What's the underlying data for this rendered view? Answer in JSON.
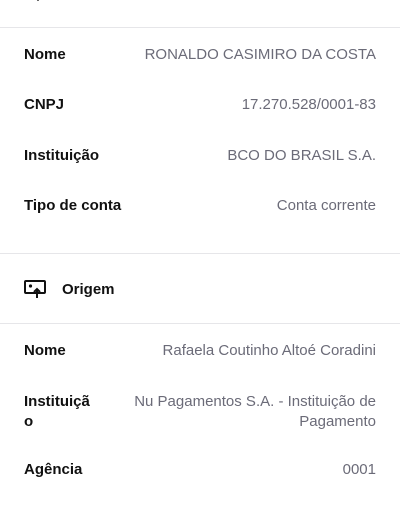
{
  "destination": {
    "rows": [
      {
        "label": "Nome",
        "value": "RONALDO CASIMIRO DA COSTA"
      },
      {
        "label": "CNPJ",
        "value": "17.270.528/0001-83"
      },
      {
        "label": "Instituição",
        "value": "BCO DO BRASIL S.A."
      },
      {
        "label": "Tipo de conta",
        "value": "Conta corrente"
      }
    ]
  },
  "origin": {
    "title": "Origem",
    "icon": "screen-upload-icon",
    "rows": [
      {
        "label": "Nome",
        "value": "Rafaela Coutinho Altoé Coradini"
      },
      {
        "label": "Instituição",
        "value": "Nu Pagamentos S.A. - Instituição de Pagamento"
      },
      {
        "label": "Agência",
        "value": "0001"
      }
    ]
  }
}
